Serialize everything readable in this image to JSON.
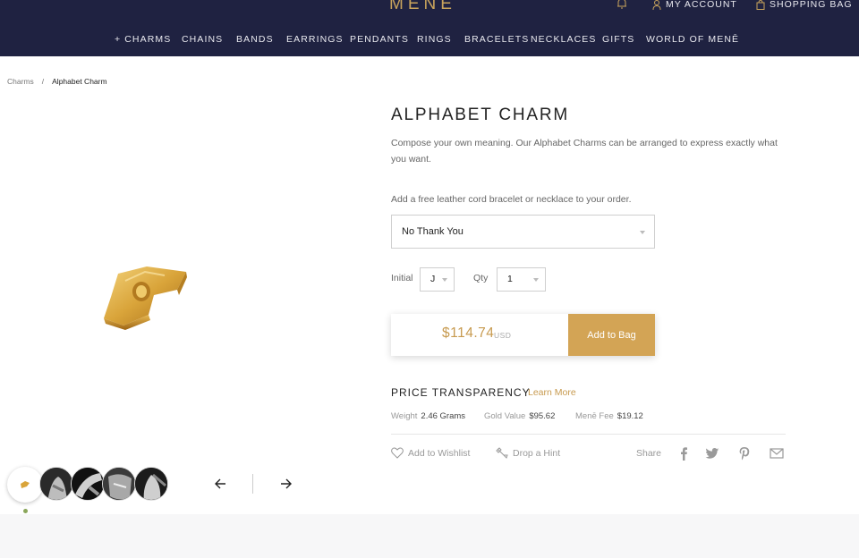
{
  "header": {
    "logo": "MENĒ",
    "account_label": "MY ACCOUNT",
    "bag_label": "SHOPPING BAG",
    "icons": [
      "bell-icon",
      "user-icon",
      "bag-icon"
    ]
  },
  "nav": {
    "items": [
      "+ CHARMS",
      "CHAINS",
      "BANDS",
      "EARRINGS",
      "PENDANTS",
      "RINGS",
      "BRACELETS",
      "NECKLACES",
      "GIFTS",
      "WORLD OF MENĒ"
    ]
  },
  "breadcrumb": {
    "items": [
      "Charms",
      "Alphabet Charm"
    ],
    "separator": "/"
  },
  "product": {
    "title": "ALPHABET CHARM",
    "description": "Compose your own meaning. Our Alphabet Charms can be arranged to express exactly what you want.",
    "cord_label": "Add a free leather cord bracelet or necklace to your order.",
    "cord_selected": "No Thank You",
    "initial_label": "Initial",
    "initial_selected": "J",
    "qty_label": "Qty",
    "qty_selected": "1",
    "price": "$114.74",
    "currency": "USD",
    "add_to_bag": "Add to Bag"
  },
  "price_transparency": {
    "title": "PRICE TRANSPARENCY",
    "learn_more": "Learn More",
    "weight_label": "Weight",
    "weight_value": "2.46 Grams",
    "gold_label": "Gold Value",
    "gold_value": "$95.62",
    "fee_label": "Menē Fee",
    "fee_value": "$19.12"
  },
  "actions": {
    "wishlist": "Add to Wishlist",
    "hint": "Drop a Hint",
    "share": "Share",
    "social_icons": [
      "facebook-icon",
      "twitter-icon",
      "pinterest-icon",
      "mail-icon"
    ]
  },
  "colors": {
    "header_bg": "#1f2241",
    "gold": "#c79a4f",
    "button_gold": "#d3a455"
  }
}
